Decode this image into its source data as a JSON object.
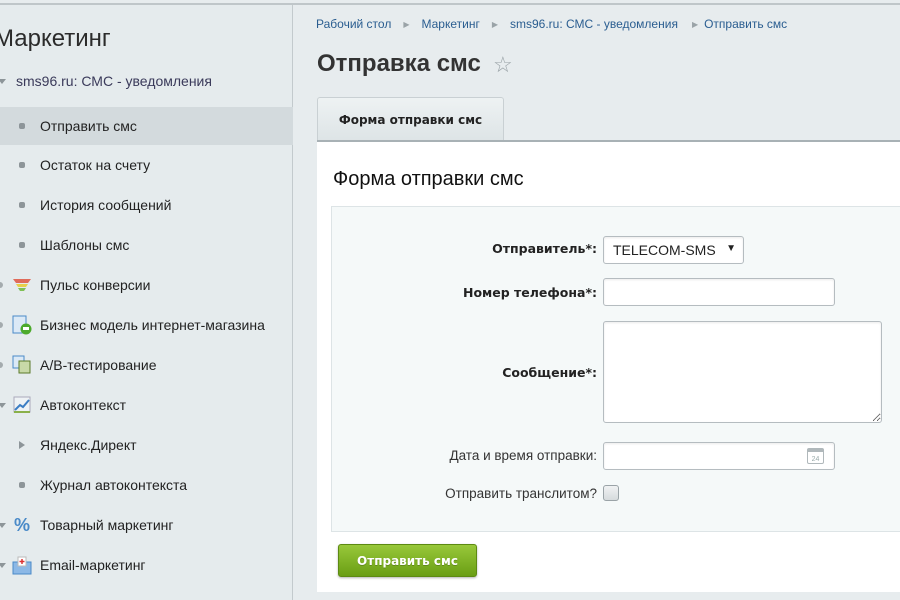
{
  "sidebar": {
    "title": "Маркетинг",
    "items": [
      {
        "label": "sms96.ru: СМС - уведомления",
        "icon": "expand-triangle-icon"
      },
      {
        "label": "Отправить смс",
        "icon": "bullet-icon",
        "selected": true
      },
      {
        "label": "Остаток на счету",
        "icon": "bullet-icon"
      },
      {
        "label": "История сообщений",
        "icon": "bullet-icon"
      },
      {
        "label": "Шаблоны смс",
        "icon": "bullet-icon"
      },
      {
        "label": "Пульс конверсии",
        "icon": "funnel-icon"
      },
      {
        "label": "Бизнес модель интернет-магазина",
        "icon": "business-model-icon"
      },
      {
        "label": "A/B-тестирование",
        "icon": "ab-test-icon"
      },
      {
        "label": "Автоконтекст",
        "icon": "chart-icon"
      },
      {
        "label": "Яндекс.Директ",
        "icon": "arrow-right-icon"
      },
      {
        "label": "Журнал автоконтекста",
        "icon": "bullet-icon"
      },
      {
        "label": "Товарный маркетинг",
        "icon": "percent-icon"
      },
      {
        "label": "Email-маркетинг",
        "icon": "email-icon"
      }
    ]
  },
  "breadcrumb": [
    "Рабочий стол",
    "Маркетинг",
    "sms96.ru: СМС - уведомления",
    "Отправить смс"
  ],
  "page": {
    "title": "Отправка смс",
    "tab": "Форма отправки смс",
    "heading": "Форма отправки смс"
  },
  "form": {
    "sender_label": "Отправитель*:",
    "sender_value": "TELECOM-SMS",
    "phone_label": "Номер телефона*:",
    "phone_value": "",
    "message_label": "Сообщение*:",
    "message_value": "",
    "date_label": "Дата и время отправки:",
    "date_value": "",
    "calendar_day": "24",
    "translit_label": "Отправить транслитом?",
    "translit_checked": false,
    "submit": "Отправить смс"
  },
  "colors": {
    "accent": "#7fb227",
    "link": "#2a5d90"
  }
}
